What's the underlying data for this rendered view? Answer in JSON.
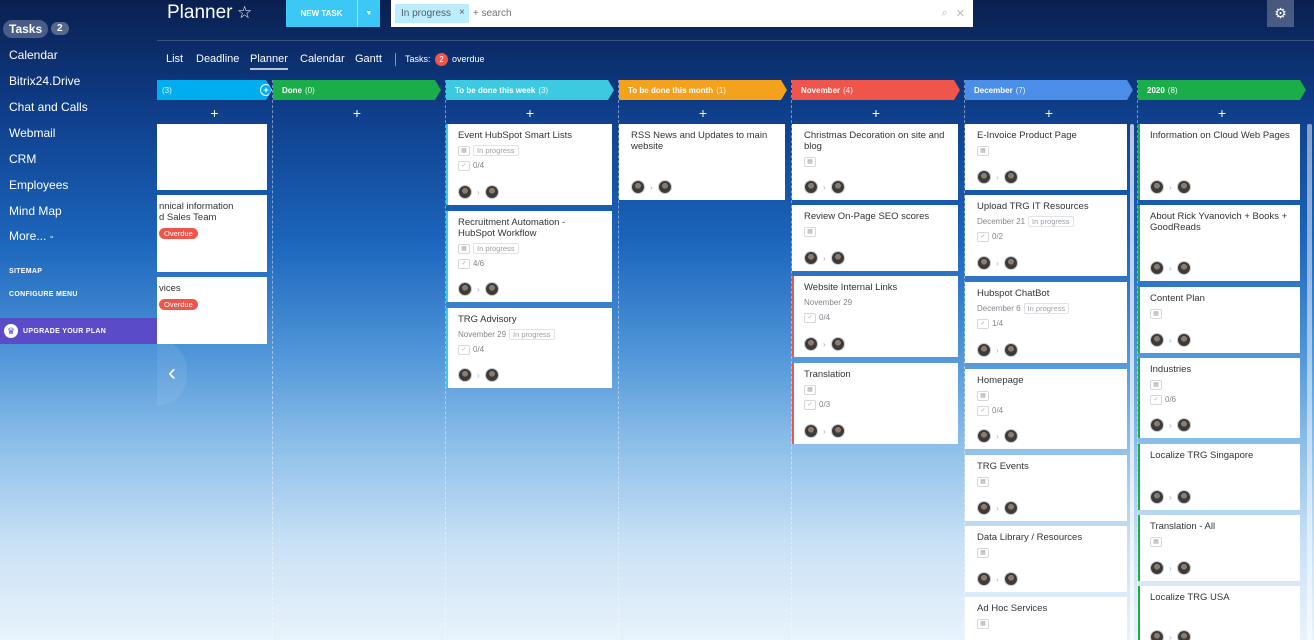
{
  "sidebar": {
    "items": [
      {
        "label": "Tasks",
        "badge": "2"
      },
      {
        "label": "Calendar"
      },
      {
        "label": "Bitrix24.Drive"
      },
      {
        "label": "Chat and Calls"
      },
      {
        "label": "Webmail"
      },
      {
        "label": "CRM"
      },
      {
        "label": "Employees"
      },
      {
        "label": "Mind Map"
      },
      {
        "label": "More... -"
      }
    ],
    "sitemap": "SITEMAP",
    "configure": "CONFIGURE MENU",
    "upgrade": "UPGRADE YOUR PLAN"
  },
  "header": {
    "title": "Planner",
    "new_task": "NEW TASK",
    "filter_chip": "In progress",
    "search_placeholder": "+ search"
  },
  "tabs": [
    "List",
    "Deadline",
    "Planner",
    "Calendar",
    "Gantt"
  ],
  "tasks_summary": {
    "label": "Tasks:",
    "count": "2",
    "overdue": "overdue"
  },
  "columns": [
    {
      "name": "",
      "count": "(3)",
      "color": "#00aeef"
    },
    {
      "name": "Done",
      "count": "(0)",
      "color": "#1aad4a"
    },
    {
      "name": "To be done this week",
      "count": "(3)",
      "color": "#3dc9e0"
    },
    {
      "name": "To be done this month",
      "count": "(1)",
      "color": "#f4a11e"
    },
    {
      "name": "November",
      "count": "(4)",
      "color": "#f0554c"
    },
    {
      "name": "December",
      "count": "(7)",
      "color": "#4a8ee8"
    },
    {
      "name": "2020",
      "count": "(8)",
      "color": "#1aad4a"
    }
  ],
  "cards": {
    "col0": [
      {
        "title": ""
      },
      {
        "title": "nnical information\nd Sales Team",
        "overdue": "Overdue"
      },
      {
        "title": "vices",
        "overdue": "Overdue"
      }
    ],
    "col2": [
      {
        "title": "Event HubSpot Smart Lists",
        "status": "In progress",
        "checklist": "0/4"
      },
      {
        "title": "Recruitment Automation - HubSpot Workflow",
        "status": "In progress",
        "checklist": "4/6"
      },
      {
        "title": "TRG Advisory",
        "deadline": "November 29",
        "status": "In progress",
        "checklist": "0/4"
      }
    ],
    "col3": [
      {
        "title": "RSS News and Updates to main website"
      }
    ],
    "col4": [
      {
        "title": "Christmas Decoration on site and blog"
      },
      {
        "title": "Review On-Page SEO scores"
      },
      {
        "title": "Website Internal Links",
        "deadline": "November 29",
        "checklist": "0/4"
      },
      {
        "title": "Translation",
        "checklist": "0/3"
      }
    ],
    "col5": [
      {
        "title": "E-Invoice Product Page"
      },
      {
        "title": "Upload TRG IT Resources",
        "deadline": "December 21",
        "status": "In progress",
        "checklist": "0/2"
      },
      {
        "title": "Hubspot ChatBot",
        "deadline": "December 6",
        "status": "In progress",
        "checklist": "1/4"
      },
      {
        "title": "Homepage",
        "checklist": "0/4"
      },
      {
        "title": "TRG Events"
      },
      {
        "title": "Data Library / Resources"
      },
      {
        "title": "Ad Hoc Services"
      }
    ],
    "col6": [
      {
        "title": "Information on Cloud Web Pages"
      },
      {
        "title": "About Rick Yvanovich + Books + GoodReads"
      },
      {
        "title": "Content Plan"
      },
      {
        "title": "Industries",
        "checklist": "0/6"
      },
      {
        "title": "Localize TRG Singapore"
      },
      {
        "title": "Translation - All"
      },
      {
        "title": "Localize TRG USA"
      }
    ]
  }
}
